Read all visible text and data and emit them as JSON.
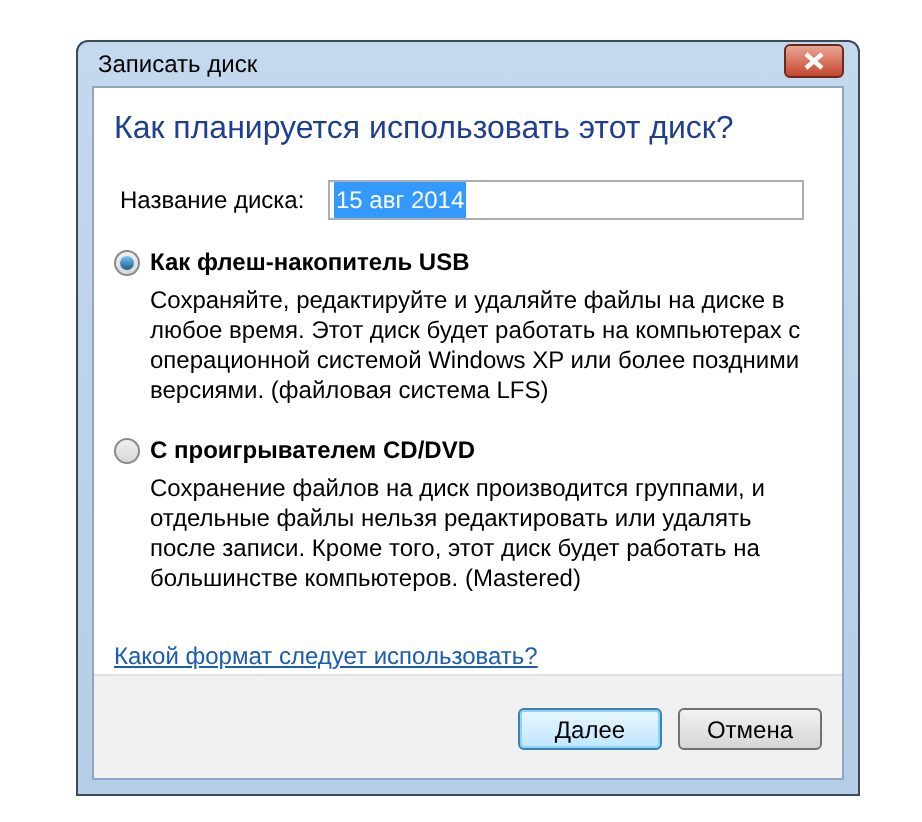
{
  "window": {
    "title": "Записать диск"
  },
  "heading": "Как планируется использовать этот диск?",
  "disk_name": {
    "label": "Название диска:",
    "value": "15 авг 2014",
    "text_selected": true
  },
  "options": [
    {
      "label": "Как флеш-накопитель USB",
      "selected": true,
      "description": "Сохраняйте, редактируйте и удаляйте файлы на диске в любое время. Этот диск будет работать на компьютерах с операционной системой Windows XP или более поздними версиями. (файловая система LFS)"
    },
    {
      "label": "С проигрывателем CD/DVD",
      "selected": false,
      "description": "Сохранение файлов на диск производится группами, и отдельные файлы нельзя редактировать или удалять после записи. Кроме того, этот диск будет работать на большинстве компьютеров. (Mastered)"
    }
  ],
  "help_link": "Какой формат следует использовать?",
  "buttons": [
    {
      "label": "Далее",
      "default": true
    },
    {
      "label": "Отмена",
      "default": false
    }
  ]
}
